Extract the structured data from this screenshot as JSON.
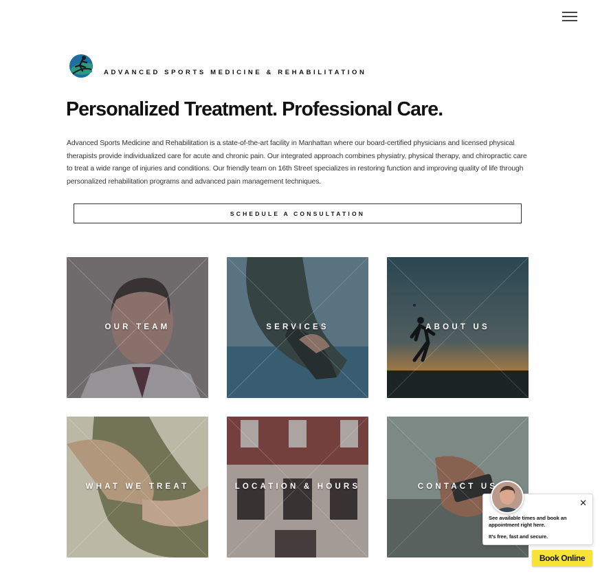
{
  "header": {
    "menu_icon": "hamburger-menu-icon"
  },
  "brand": {
    "name": "ADVANCED SPORTS MEDICINE & REHABILITATION",
    "logo_icon": "runner-globe-logo"
  },
  "hero": {
    "headline": "Personalized Treatment. Professional Care.",
    "intro": "Advanced Sports Medicine and Rehabilitation is a state-of-the-art facility in Manhattan where our board-certified physicians and licensed physical therapists provide individualized care for acute and chronic pain. Our integrated approach combines physiatry, physical therapy, and chiropractic care to treat a wide range of injuries and conditions. Our friendly team on 16th Street specializes in restoring function and improving quality of life through personalized rehabilitation programs and advanced pain management techniques.",
    "cta_label": "SCHEDULE A CONSULTATION"
  },
  "tiles": [
    {
      "label": "OUR TEAM"
    },
    {
      "label": "SERVICES"
    },
    {
      "label": "ABOUT US"
    },
    {
      "label": "WHAT WE TREAT"
    },
    {
      "label": "LOCATION & HOURS"
    },
    {
      "label": "CONTACT US"
    }
  ],
  "booking_widget": {
    "message": "See available times and book an appointment right here.",
    "subtext": "It's free, fast and secure.",
    "button_label": "Book Online",
    "close_icon": "close-icon",
    "button_color": "#f7e436"
  }
}
